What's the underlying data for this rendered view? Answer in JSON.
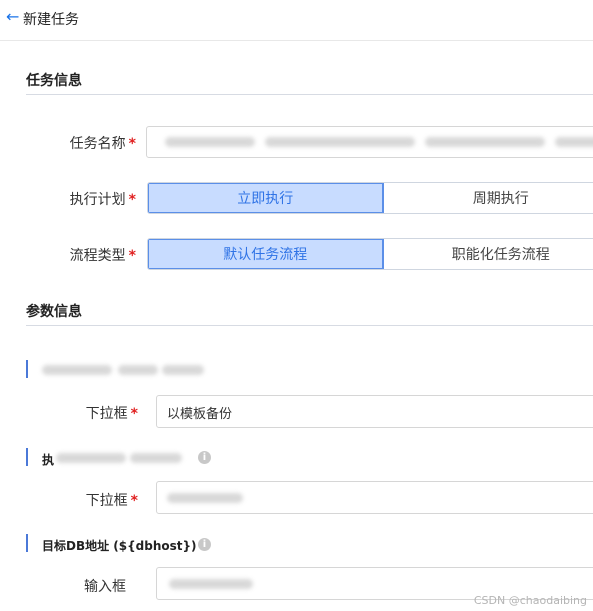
{
  "header": {
    "back_icon": "arrow-left-icon",
    "title": "新建任务"
  },
  "sections": {
    "task_info_title": "任务信息",
    "param_info_title": "参数信息"
  },
  "task_form": {
    "name_label": "任务名称",
    "required_mark": "*",
    "schedule_label": "执行计划",
    "schedule_options": [
      "立即执行",
      "周期执行"
    ],
    "schedule_selected": "立即执行",
    "flow_label": "流程类型",
    "flow_options": [
      "默认任务流程",
      "职能化任务流程"
    ],
    "flow_selected": "默认任务流程"
  },
  "params": {
    "p1": {
      "control_label": "下拉框",
      "value": "以模板备份"
    },
    "p2": {
      "title_prefix": "执",
      "control_label": "下拉框"
    },
    "p3": {
      "title": "目标DB地址 (${dbhost})",
      "control_label": "输入框"
    },
    "info_glyph": "i"
  },
  "watermark": "CSDN @chaodaibing",
  "colors": {
    "accent": "#2f73e6",
    "selected_bg": "#c8dcff",
    "required": "#e02020"
  }
}
